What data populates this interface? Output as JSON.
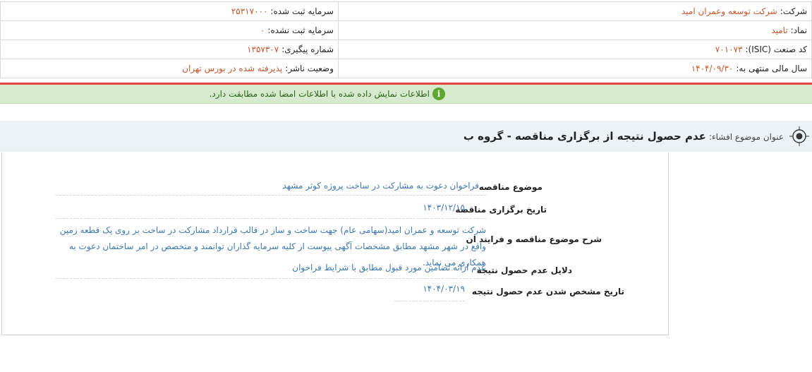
{
  "company_info": {
    "company_label": "شرکت:",
    "company_value": "شرکت توسعه وعمران امید",
    "capital_registered_label": "سرمایه ثبت شده:",
    "capital_registered_value": "۲۵۳۱۷۰۰۰",
    "symbol_label": "نماد:",
    "symbol_value": "تامید",
    "capital_unregistered_label": "سرمایه ثبت نشده:",
    "capital_unregistered_value": "۰",
    "isic_label": "کد صنعت (ISIC):",
    "isic_value": "۷۰۱۰۷۳",
    "tracking_label": "شماره پیگیری:",
    "tracking_value": "۱۳۵۷۳۰۷",
    "fiscal_year_label": "سال مالی منتهی به:",
    "fiscal_year_value": "۱۴۰۴/۰۹/۳۰",
    "publisher_status_label": "وضعیت ناشر:",
    "publisher_status_value": "پذیرفته شده در بورس تهران"
  },
  "alert": {
    "icon": "info-icon",
    "text": "اطلاعات نمایش داده شده با اطلاعات امضا شده مطابقت دارد."
  },
  "disclosure": {
    "label": "عنوان موضوع افشاء:",
    "title": "عدم حصول نتیجه از برگزاری مناقصه - گروه ب",
    "icon": "target-icon"
  },
  "details": {
    "tender_subject_label": "موضوع مناقصه",
    "tender_subject_value": "فراخوان دعوت به مشارکت در ساخت پروژه کوثر مشهد",
    "tender_date_label": "تاریخ برگزاری مناقصه",
    "tender_date_value": "۱۴۰۳/۱۲/۱۵",
    "description_label": "شرح موضوع مناقصه و فرایند ان",
    "description_value": "شرکت توسعه و عمران امید(سهامی عام) جهت ساخت و ساز در قالب قرارداد مشارکت در ساخت بر روی یک قطعه زمین واقع در شهر مشهد مطابق مشخصات آگهی پیوست از کلیه سرمایه گذاران توانمند و متخصص در امر ساختمان دعوت به همکاری می نماید.",
    "reasons_label": "دلایل عدم حصول نتیجه",
    "reasons_value": "عدم ارائه تضامین مورد قبول مطابق با شرایط فراخوان",
    "result_date_label": "تاریخ مشخص شدن عدم حصول نتیجه",
    "result_date_value": "۱۴۰۴/۰۳/۱۹"
  },
  "colors": {
    "value_orange": "#c8572e",
    "value_blue": "#3d78b0",
    "alert_green": "#d6ebcd",
    "red_rule": "#e8423f"
  }
}
